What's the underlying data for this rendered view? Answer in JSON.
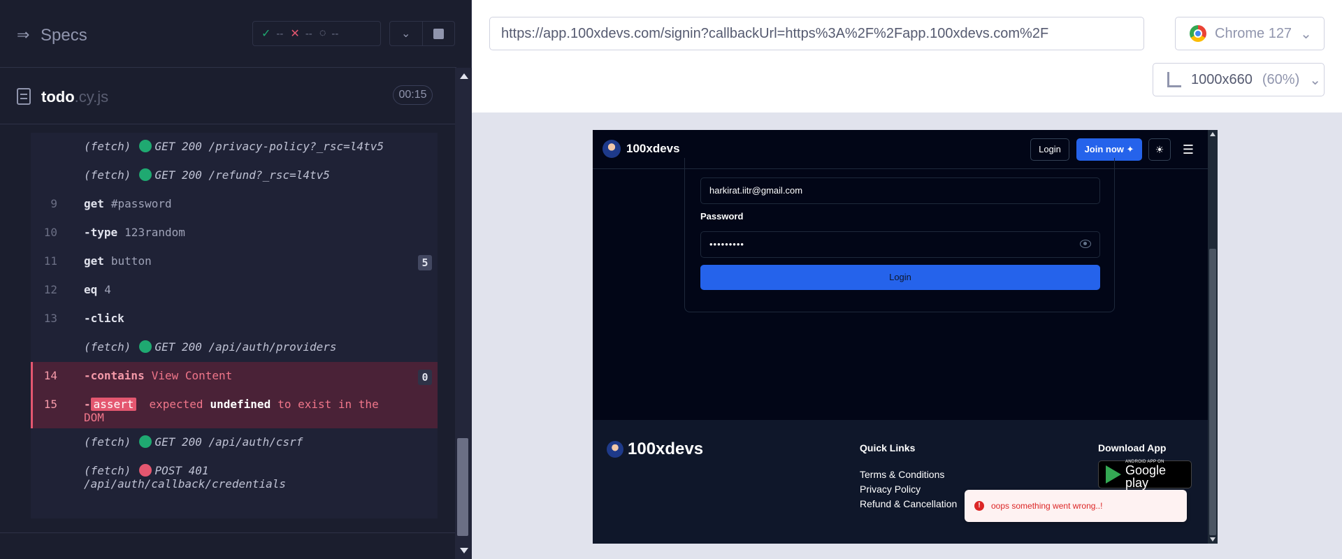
{
  "specs": {
    "title": "Specs",
    "stats": {
      "passed": "--",
      "failed": "--",
      "pending": "--"
    }
  },
  "spec_file": {
    "name": "todo",
    "ext": ".cy.js",
    "duration": "00:15"
  },
  "commands": [
    {
      "num": "",
      "name": "(fetch)",
      "status": "green",
      "msg": "GET 200 /privacy-policy?_rsc=l4tv5"
    },
    {
      "num": "",
      "name": "(fetch)",
      "status": "green",
      "msg": "GET 200 /refund?_rsc=l4tv5"
    },
    {
      "num": "9",
      "name": "get",
      "msg": "#password"
    },
    {
      "num": "10",
      "name": "-type",
      "msg": "123random"
    },
    {
      "num": "11",
      "name": "get",
      "msg": "button",
      "badge": "5"
    },
    {
      "num": "12",
      "name": "eq",
      "msg": "4"
    },
    {
      "num": "13",
      "name": "-click",
      "msg": ""
    },
    {
      "num": "",
      "name": "(fetch)",
      "status": "green",
      "msg": "GET 200 /api/auth/providers"
    },
    {
      "num": "14",
      "name": "-contains",
      "msg": "View Content",
      "badge": "0"
    },
    {
      "num": "15",
      "name": "-",
      "tag": "assert",
      "msg_before": "expected",
      "msg_hl": "undefined",
      "msg_after": "to exist in the",
      "msg_wrap": "DOM"
    },
    {
      "num": "",
      "name": "(fetch)",
      "status": "green",
      "msg": "GET 200 /api/auth/csrf"
    },
    {
      "num": "",
      "name": "(fetch)",
      "status": "red",
      "msg": "POST 401",
      "msg_wrap": "/api/auth/callback/credentials"
    }
  ],
  "aut": {
    "url": "https://app.100xdevs.com/signin?callbackUrl=https%3A%2F%2Fapp.100xdevs.com%2F",
    "browser": "Chrome 127",
    "viewport": "1000x660",
    "scale": "(60%)"
  },
  "site": {
    "brand": "100xdevs",
    "nav_login": "Login",
    "nav_join": "Join now",
    "email_value": "harkirat.iitr@gmail.com",
    "password_label": "Password",
    "password_value": "•••••••••",
    "submit_label": "Login",
    "footer": {
      "quick_links_title": "Quick Links",
      "links": [
        "Terms & Conditions",
        "Privacy Policy",
        "Refund & Cancellation"
      ],
      "download_title": "Download App",
      "play_small": "ANDROID APP ON",
      "play_big": "Google play"
    },
    "toast": "oops something went wrong..!"
  }
}
